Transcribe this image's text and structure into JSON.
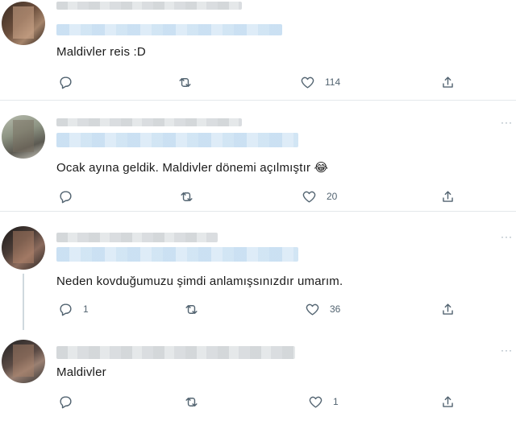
{
  "tweets": [
    {
      "text": "Maldivler reis :D",
      "reply_count": "",
      "like_count": "114"
    },
    {
      "text": "Ocak ayına geldik. Maldivler dönemi açılmıştır 😂",
      "reply_count": "",
      "like_count": "20"
    },
    {
      "text": "Neden kovduğumuzu şimdi anlamışsınızdır umarım.",
      "reply_count": "1",
      "like_count": "36"
    },
    {
      "text": "Maldivler",
      "reply_count": "",
      "like_count": "1"
    }
  ],
  "icons": {
    "reply": "reply-icon",
    "retweet": "retweet-icon",
    "like": "heart-icon",
    "share": "share-icon",
    "more": "more-icon"
  },
  "colors": {
    "icon": "#536471",
    "divider": "#e4e8eb",
    "thread": "#cfd9de"
  }
}
